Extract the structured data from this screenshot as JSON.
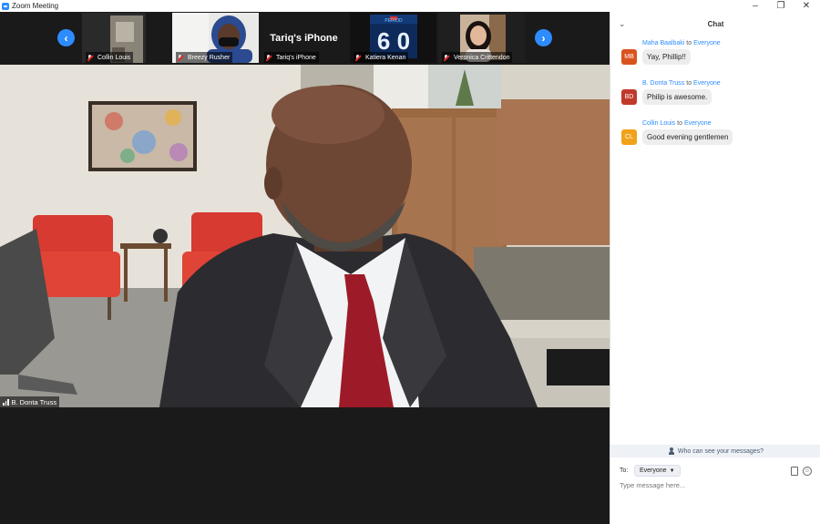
{
  "window": {
    "title": "Zoom Meeting",
    "controls": [
      "minimize-icon",
      "restore-icon",
      "close-icon"
    ]
  },
  "gallery": {
    "prev_icon": "chevron-left-icon",
    "next_icon": "chevron-right-icon",
    "participants": [
      {
        "name": "Collin Louis",
        "muted": true
      },
      {
        "name": "Breezy Rusher",
        "muted": true
      },
      {
        "name": "Tariq's iPhone",
        "muted": true,
        "display_name": "Tariq's iPhone"
      },
      {
        "name": "Katiera Kenan",
        "muted": true,
        "tile_text": "6 0"
      },
      {
        "name": "Veronica Crittendon",
        "muted": true
      }
    ]
  },
  "active_speaker": {
    "name": "B. Donta Truss"
  },
  "chat": {
    "title": "Chat",
    "messages": [
      {
        "sender": "Maha Baalbaki",
        "initials": "MB",
        "color": "#d9531e",
        "to_word": "to",
        "to": "Everyone",
        "text": "Yay, Phillip!!"
      },
      {
        "sender": "B. Donta Truss",
        "initials": "BD",
        "color": "#c0392b",
        "to_word": "to",
        "to": "Everyone",
        "text": "Philip is awesome."
      },
      {
        "sender": "Collin Louis",
        "initials": "CL",
        "color": "#f0a21a",
        "to_word": "to",
        "to": "Everyone",
        "text": "Good evening gentlemen"
      }
    ],
    "visibility_text": "Who can see your messages?",
    "to_label": "To:",
    "recipient": "Everyone",
    "placeholder": "Type message here..."
  }
}
